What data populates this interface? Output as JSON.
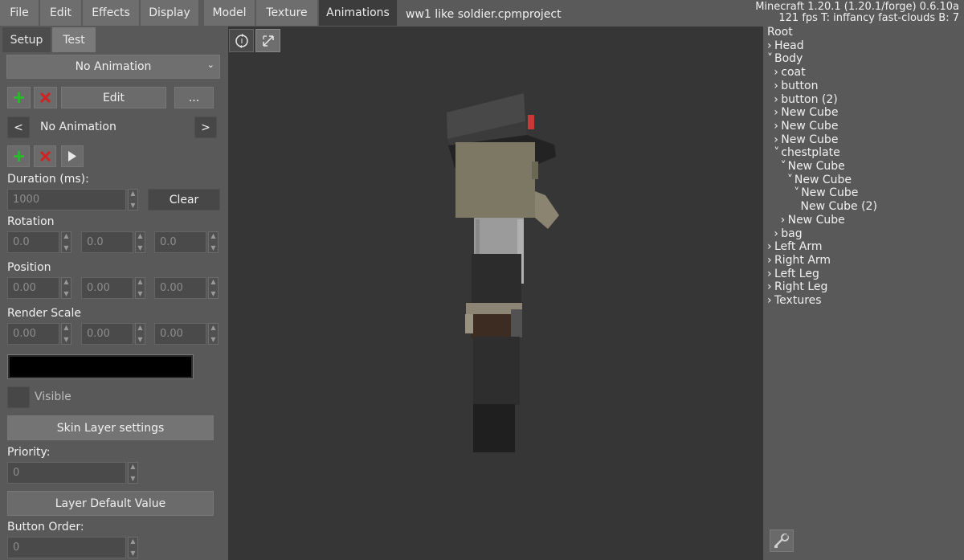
{
  "menu": {
    "file": "File",
    "edit": "Edit",
    "effects": "Effects",
    "display": "Display",
    "model": "Model",
    "texture": "Texture",
    "animations": "Animations"
  },
  "project_title": "ww1 like soldier.cpmproject",
  "info": {
    "line1": "Minecraft 1.20.1 (1.20.1/forge) 0.6.10a",
    "line2": "121 fps T: inffancy fast-clouds B: 7"
  },
  "left_tabs": {
    "setup": "Setup",
    "test": "Test"
  },
  "animation": {
    "dropdown_value": "No Animation",
    "edit_label": "Edit",
    "more_label": "...",
    "nav_prev": "<",
    "nav_next": ">",
    "current_name": "No Animation",
    "duration_label": "Duration (ms):",
    "duration_value": "1000",
    "clear_label": "Clear",
    "rotation_label": "Rotation",
    "rotation": [
      "0.0",
      "0.0",
      "0.0"
    ],
    "position_label": "Position",
    "position": [
      "0.00",
      "0.00",
      "0.00"
    ],
    "render_scale_label": "Render Scale",
    "render_scale": [
      "0.00",
      "0.00",
      "0.00"
    ],
    "color_value": "#000000",
    "visible_label": "Visible",
    "skin_layer_label": "Skin Layer settings",
    "priority_label": "Priority:",
    "priority_value": "0",
    "layer_default_label": "Layer Default Value",
    "button_order_label": "Button Order:",
    "button_order_value": "0"
  },
  "tree": [
    {
      "label": "Root",
      "indent": 0,
      "arrow": ""
    },
    {
      "label": "Head",
      "indent": 0,
      "arrow": ">"
    },
    {
      "label": "Body",
      "indent": 0,
      "arrow": "v"
    },
    {
      "label": "coat",
      "indent": 1,
      "arrow": ">"
    },
    {
      "label": "button",
      "indent": 1,
      "arrow": ">"
    },
    {
      "label": "button (2)",
      "indent": 1,
      "arrow": ">"
    },
    {
      "label": "New Cube",
      "indent": 1,
      "arrow": ">"
    },
    {
      "label": "New Cube",
      "indent": 1,
      "arrow": ">"
    },
    {
      "label": "New Cube",
      "indent": 1,
      "arrow": ">"
    },
    {
      "label": "chestplate",
      "indent": 1,
      "arrow": "v"
    },
    {
      "label": "New Cube",
      "indent": 2,
      "arrow": "v"
    },
    {
      "label": "New Cube",
      "indent": 3,
      "arrow": "v"
    },
    {
      "label": "New Cube",
      "indent": 4,
      "arrow": "v"
    },
    {
      "label": "New Cube (2)",
      "indent": 5,
      "arrow": ""
    },
    {
      "label": "New Cube",
      "indent": 2,
      "arrow": ">"
    },
    {
      "label": "bag",
      "indent": 1,
      "arrow": ">"
    },
    {
      "label": "Left Arm",
      "indent": 0,
      "arrow": ">"
    },
    {
      "label": "Right Arm",
      "indent": 0,
      "arrow": ">"
    },
    {
      "label": "Left Leg",
      "indent": 0,
      "arrow": ">"
    },
    {
      "label": "Right Leg",
      "indent": 0,
      "arrow": ">"
    },
    {
      "label": "Textures",
      "indent": 0,
      "arrow": ">"
    }
  ],
  "colors": {
    "add_green": "#2fb52f",
    "remove_red": "#d42020",
    "hat_red": "#c83a3a"
  }
}
